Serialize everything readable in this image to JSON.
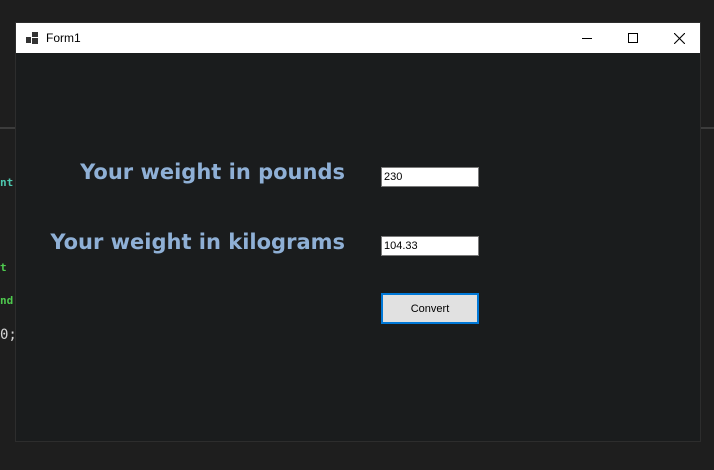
{
  "background_code": {
    "frag1": "nt.",
    "frag2": "t",
    "frag3": "nd.",
    "frag4": "0;"
  },
  "window": {
    "title": "Form1",
    "icon": "winforms-app-icon",
    "controls": [
      "minimize-icon",
      "maximize-icon",
      "close-icon"
    ]
  },
  "form": {
    "pounds_label": "Your weight in pounds",
    "pounds_value": "230",
    "kilograms_label": "Your weight in kilograms",
    "kilograms_value": "104.33",
    "convert_label": "Convert"
  },
  "colors": {
    "label": "#8fb0d6",
    "form_background": "#1a1c1d",
    "button_border": "#0078d7"
  }
}
